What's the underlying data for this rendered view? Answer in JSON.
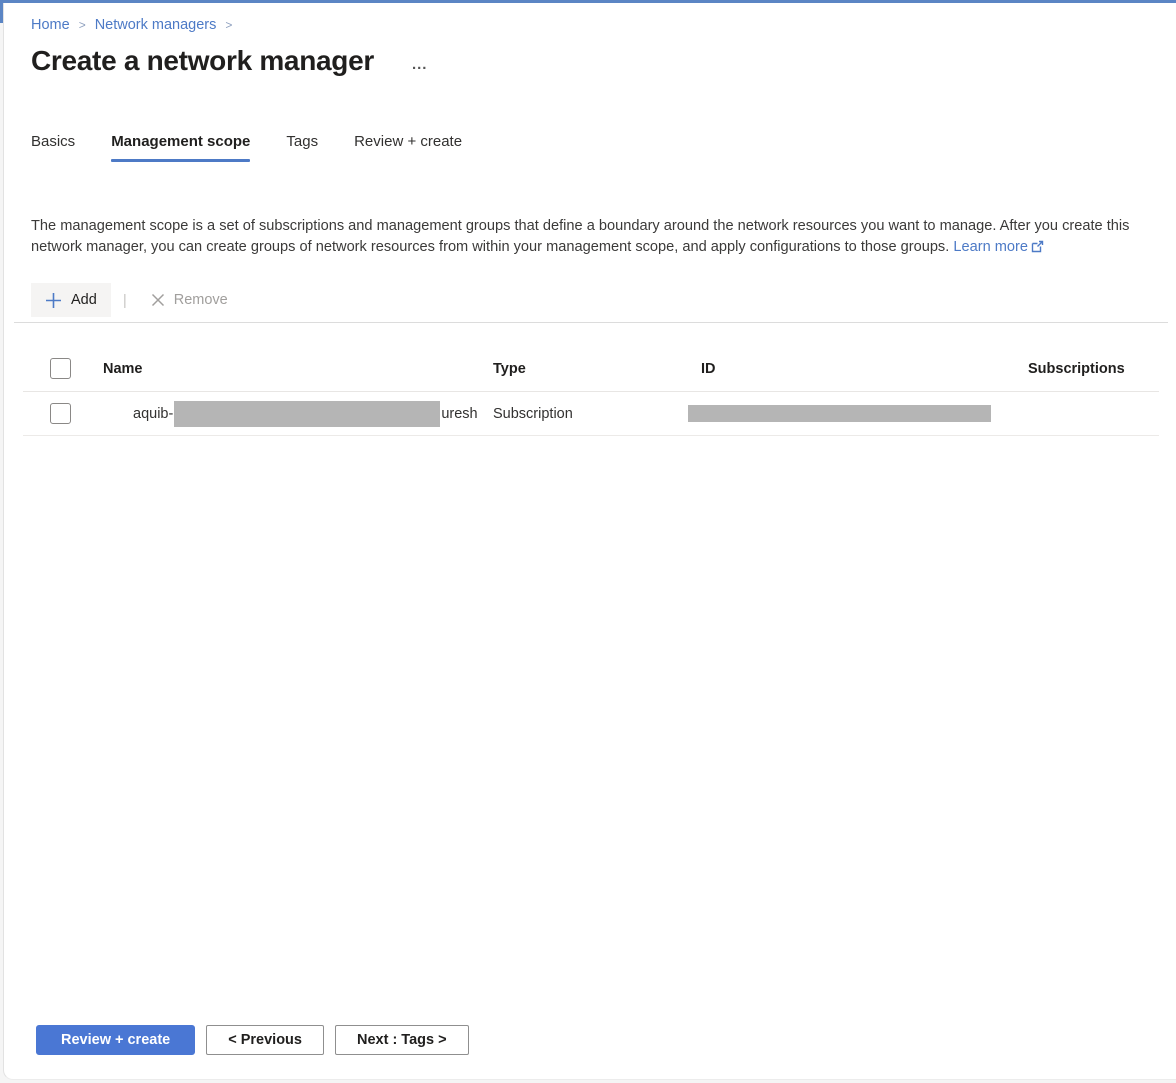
{
  "breadcrumb": {
    "items": [
      {
        "label": "Home"
      },
      {
        "label": "Network managers"
      }
    ],
    "separator": ">"
  },
  "header": {
    "title": "Create a network manager",
    "more_options": "..."
  },
  "tabs": [
    {
      "label": "Basics",
      "active": false
    },
    {
      "label": "Management scope",
      "active": true
    },
    {
      "label": "Tags",
      "active": false
    },
    {
      "label": "Review + create",
      "active": false
    }
  ],
  "description": {
    "text": "The management scope is a set of subscriptions and management groups that define a boundary around the network resources you want to manage. After you create this network manager, you can create groups of network resources from within your management scope, and apply configurations to those groups.",
    "link_label": "Learn more",
    "link_icon": "external-link-icon"
  },
  "toolbar": {
    "add_label": "Add",
    "add_icon": "plus-icon",
    "separator": "|",
    "remove_label": "Remove",
    "remove_icon": "x-icon",
    "remove_disabled": true
  },
  "table": {
    "columns": [
      "Name",
      "Type",
      "ID",
      "Subscriptions"
    ],
    "rows": [
      {
        "name_prefix": "aquib-",
        "name_redacted": true,
        "name_suffix": "uresh",
        "type": "Subscription",
        "id_redacted": true,
        "subscriptions": ""
      }
    ]
  },
  "footer": {
    "review_create_label": "Review + create",
    "previous_label": "< Previous",
    "next_label": "Next : Tags >"
  },
  "colors": {
    "accent_top_border": "#5b85c4",
    "link_blue": "#4d7ac6",
    "tab_underline": "#4d7ac6",
    "primary_button": "#4a77d4",
    "redaction_gray": "#b5b5b5",
    "disabled_gray": "#a19f9d"
  }
}
